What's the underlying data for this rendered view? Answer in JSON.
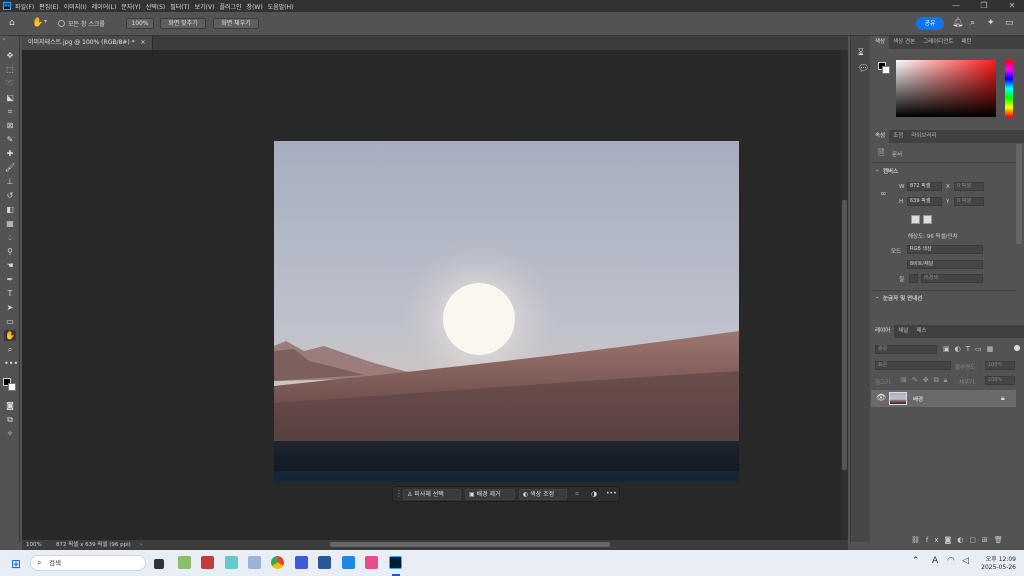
{
  "app": {
    "logo": "Ps"
  },
  "menu": [
    "파일(F)",
    "편집(E)",
    "이미지(I)",
    "레이어(L)",
    "문자(Y)",
    "선택(S)",
    "필터(T)",
    "보기(V)",
    "플러그인",
    "창(W)",
    "도움말(H)"
  ],
  "window_controls": {
    "minimize": "—",
    "restore": "❐",
    "close": "✕"
  },
  "options_bar": {
    "all_windows_scroll": "모든 창 스크롤",
    "zoom": "100%",
    "fit_screen": "화면 맞추기",
    "fill_screen": "화면 채우기",
    "share": "공유"
  },
  "document": {
    "tab_title": "이미지테스트.jpg @ 100% (RGB/8#) *",
    "close": "×",
    "status_zoom": "100%",
    "status_info": "872 픽셀 x 639 픽셀 (96 ppi)",
    "status_arrow": "›"
  },
  "context_bar": {
    "select_subject": "피사체 선택",
    "remove_bg": "배경 제거",
    "color_adjust": "색상 조정",
    "more": "•••"
  },
  "color_panel": {
    "tabs": [
      "색상",
      "색상 견본",
      "그레이디언트",
      "패턴"
    ],
    "active_tab": 0,
    "hue_color": "#ff1a1a"
  },
  "properties_panel": {
    "tabs": [
      "속성",
      "조정",
      "라이브러리"
    ],
    "doc_label": "문서",
    "canvas_section": "캔버스",
    "w_label": "W",
    "w_value": "872 픽셀",
    "h_label": "H",
    "h_value": "639 픽셀",
    "x_label": "X",
    "x_value": "0 픽셀",
    "y_label": "Y",
    "y_value": "0 픽셀",
    "resolution": "해상도: 96 픽셀/인치",
    "mode_label": "모드",
    "mode_value": "RGB 색상",
    "bit_value": "8비트/채널",
    "fill_label": "칠",
    "fill_value": "배경색",
    "rulers_section": "눈금자 및 안내선"
  },
  "layers_panel": {
    "tabs": [
      "레이어",
      "채널",
      "패스"
    ],
    "search_placeholder": "종류",
    "blend_mode": "표준",
    "opacity_label": "불투명도:",
    "opacity_value": "100%",
    "lock_label": "잠그기:",
    "fill_label": "채우기:",
    "fill_value": "100%",
    "layer_name": "배경"
  },
  "taskbar": {
    "search_placeholder": "검색",
    "time": "오후 12:09",
    "date": "2025-05-26"
  }
}
